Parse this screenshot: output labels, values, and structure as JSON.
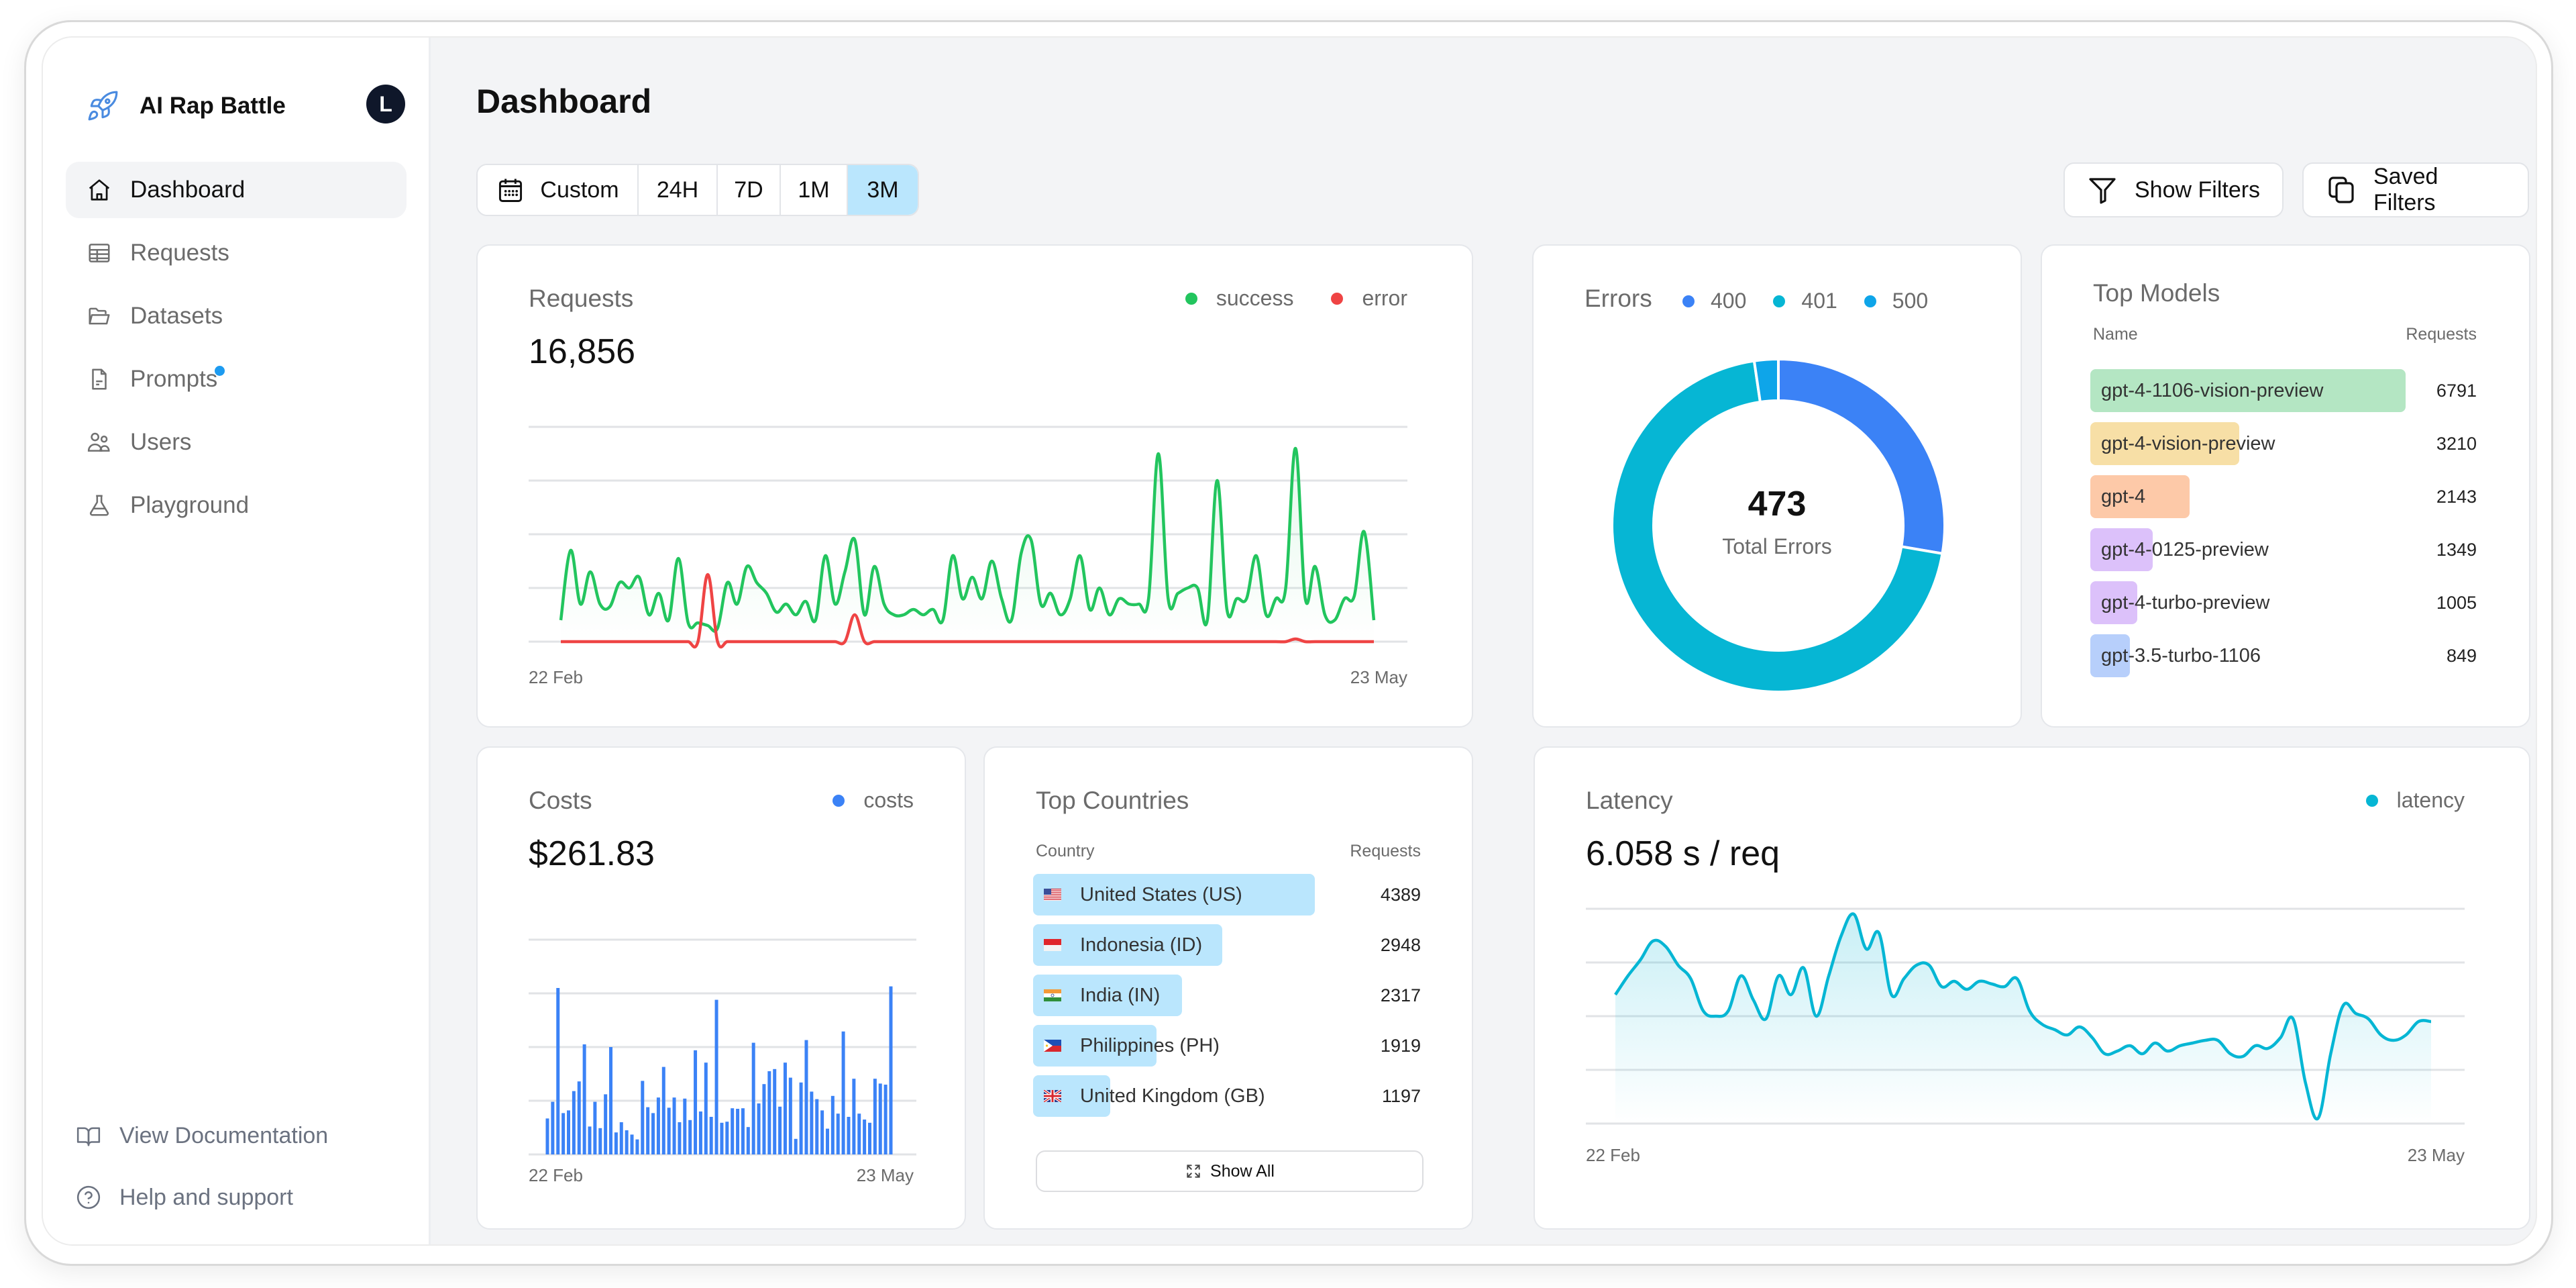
{
  "app": {
    "name": "AI Rap Battle",
    "avatar_initial": "L"
  },
  "sidebar": {
    "items": [
      {
        "label": "Dashboard",
        "icon": "home-icon",
        "active": true
      },
      {
        "label": "Requests",
        "icon": "table-icon",
        "active": false
      },
      {
        "label": "Datasets",
        "icon": "folder-icon",
        "active": false
      },
      {
        "label": "Prompts",
        "icon": "document-icon",
        "active": false,
        "badge_dot": true
      },
      {
        "label": "Users",
        "icon": "users-icon",
        "active": false
      },
      {
        "label": "Playground",
        "icon": "beaker-icon",
        "active": false
      }
    ],
    "footer": [
      {
        "label": "View Documentation",
        "icon": "book-icon"
      },
      {
        "label": "Help and support",
        "icon": "help-circle-icon"
      }
    ]
  },
  "header": {
    "title": "Dashboard",
    "time_range": {
      "options": [
        "Custom",
        "24H",
        "7D",
        "1M",
        "3M"
      ],
      "selected": "3M"
    },
    "show_filters_label": "Show Filters",
    "saved_filters_label": "Saved Filters"
  },
  "colors": {
    "success": "#22c55e",
    "error": "#ef4444",
    "costs": "#3b82f6",
    "latency": "#06b6d4",
    "err400": "#3b82f6",
    "err401": "#06b6d4",
    "err500": "#0ea5e9",
    "selected_range": "#bae6fd",
    "country_bar": "#bae6fd"
  },
  "requests_card": {
    "title": "Requests",
    "total": "16,856",
    "legend": [
      "success",
      "error"
    ],
    "x_start": "22 Feb",
    "x_end": "23 May"
  },
  "errors_card": {
    "title": "Errors",
    "legend": [
      "400",
      "401",
      "500"
    ],
    "total": "473",
    "total_label": "Total Errors"
  },
  "top_models": {
    "title": "Top Models",
    "col_name": "Name",
    "col_requests": "Requests",
    "rows": [
      {
        "name": "gpt-4-1106-vision-preview",
        "requests": "6791",
        "color": "#b4e6c3"
      },
      {
        "name": "gpt-4-vision-preview",
        "requests": "3210",
        "color": "#f7dfa6"
      },
      {
        "name": "gpt-4",
        "requests": "2143",
        "color": "#fdc9a8"
      },
      {
        "name": "gpt-4-0125-preview",
        "requests": "1349",
        "color": "#dcc1fa"
      },
      {
        "name": "gpt-4-turbo-preview",
        "requests": "1005",
        "color": "#dcc1fa"
      },
      {
        "name": "gpt-3.5-turbo-1106",
        "requests": "849",
        "color": "#b7cffb"
      }
    ]
  },
  "costs_card": {
    "title": "Costs",
    "total": "$261.83",
    "legend": [
      "costs"
    ],
    "x_start": "22 Feb",
    "x_end": "23 May"
  },
  "top_countries": {
    "title": "Top Countries",
    "col_country": "Country",
    "col_requests": "Requests",
    "rows": [
      {
        "name": "United States (US)",
        "flag": "us",
        "requests": "4389"
      },
      {
        "name": "Indonesia (ID)",
        "flag": "id",
        "requests": "2948"
      },
      {
        "name": "India (IN)",
        "flag": "in",
        "requests": "2317"
      },
      {
        "name": "Philippines (PH)",
        "flag": "ph",
        "requests": "1919"
      },
      {
        "name": "United Kingdom (GB)",
        "flag": "gb",
        "requests": "1197"
      }
    ],
    "show_all_label": "Show All"
  },
  "latency_card": {
    "title": "Latency",
    "value": "6.058 s / req",
    "legend": [
      "latency"
    ],
    "x_start": "22 Feb",
    "x_end": "23 May"
  },
  "chart_data": [
    {
      "type": "line",
      "title": "Requests",
      "x_range": [
        "22 Feb",
        "23 May"
      ],
      "grid": true,
      "ylim": [
        0,
        4
      ],
      "series": [
        {
          "name": "success",
          "values": [
            0.4,
            1.7,
            0.7,
            1.3,
            0.7,
            0.65,
            1.1,
            1.0,
            1.2,
            0.5,
            0.9,
            0.4,
            1.55,
            0.35,
            0.35,
            0.3,
            0.25,
            1.1,
            0.7,
            1.4,
            1.1,
            0.9,
            0.55,
            0.7,
            0.5,
            0.75,
            0.4,
            1.6,
            0.7,
            1.3,
            1.9,
            0.5,
            1.4,
            0.7,
            0.5,
            0.5,
            0.6,
            0.5,
            0.6,
            0.4,
            1.6,
            0.8,
            1.2,
            0.8,
            1.5,
            0.8,
            0.4,
            1.65,
            1.9,
            0.7,
            0.9,
            0.5,
            0.8,
            1.6,
            0.6,
            1.0,
            0.5,
            0.8,
            0.7,
            0.7,
            0.8,
            3.5,
            0.8,
            0.9,
            1.0,
            1.0,
            0.4,
            3.0,
            0.6,
            0.8,
            0.8,
            1.6,
            0.5,
            0.8,
            1.0,
            3.6,
            0.8,
            1.4,
            0.5,
            0.4,
            0.8,
            0.85,
            2.05,
            0.4
          ]
        },
        {
          "name": "error",
          "values": [
            0,
            0,
            0,
            0,
            0,
            0,
            0,
            0,
            0,
            0,
            0,
            0,
            0,
            0,
            0,
            1.25,
            0,
            0,
            0,
            0,
            0,
            0,
            0,
            0,
            0,
            0,
            0,
            0,
            0,
            0,
            0.5,
            0,
            0,
            0,
            0,
            0,
            0,
            0,
            0,
            0,
            0,
            0,
            0,
            0,
            0,
            0,
            0,
            0,
            0,
            0,
            0,
            0,
            0,
            0,
            0,
            0,
            0,
            0,
            0,
            0,
            0,
            0,
            0,
            0,
            0,
            0,
            0,
            0,
            0,
            0,
            0,
            0,
            0,
            0,
            0,
            0.05,
            0,
            0,
            0,
            0,
            0,
            0,
            0,
            0
          ]
        }
      ]
    },
    {
      "type": "pie",
      "title": "Errors",
      "donut": true,
      "categories": [
        "400",
        "401",
        "500"
      ],
      "values": [
        131,
        331,
        11
      ],
      "center_label": "473 Total Errors"
    },
    {
      "type": "bar",
      "title": "Top Models",
      "orientation": "horizontal",
      "categories": [
        "gpt-4-1106-vision-preview",
        "gpt-4-vision-preview",
        "gpt-4",
        "gpt-4-0125-preview",
        "gpt-4-turbo-preview",
        "gpt-3.5-turbo-1106"
      ],
      "values": [
        6791,
        3210,
        2143,
        1349,
        1005,
        849
      ]
    },
    {
      "type": "bar",
      "title": "Costs",
      "x_range": [
        "22 Feb",
        "23 May"
      ],
      "grid": true,
      "ylim": [
        0,
        4
      ],
      "values": [
        0.67,
        0.98,
        3.1,
        0.77,
        0.82,
        1.18,
        1.36,
        2.05,
        0.52,
        0.98,
        0.49,
        1.12,
        2.0,
        0.41,
        0.6,
        0.45,
        0.37,
        0.28,
        1.37,
        0.88,
        0.77,
        1.06,
        1.63,
        0.87,
        1.06,
        0.6,
        1.04,
        0.64,
        1.94,
        0.8,
        1.71,
        0.7,
        2.88,
        0.59,
        0.61,
        0.86,
        0.85,
        0.86,
        0.51,
        2.08,
        0.95,
        1.31,
        1.55,
        1.59,
        0.89,
        1.71,
        1.43,
        0.29,
        1.34,
        2.13,
        1.17,
        1.03,
        0.82,
        0.48,
        1.09,
        0.76,
        2.29,
        0.7,
        1.41,
        0.76,
        0.65,
        0.59,
        1.41,
        1.32,
        1.3,
        3.13
      ]
    },
    {
      "type": "bar",
      "title": "Top Countries",
      "orientation": "horizontal",
      "categories": [
        "United States (US)",
        "Indonesia (ID)",
        "India (IN)",
        "Philippines (PH)",
        "United Kingdom (GB)"
      ],
      "values": [
        4389,
        2948,
        2317,
        1919,
        1197
      ]
    },
    {
      "type": "area",
      "title": "Latency",
      "x_range": [
        "22 Feb",
        "23 May"
      ],
      "grid": true,
      "ylim": [
        0,
        4
      ],
      "series": [
        {
          "name": "latency",
          "values": [
            2.4,
            2.75,
            3.05,
            3.4,
            3.3,
            2.95,
            2.7,
            2.1,
            2.0,
            2.1,
            2.75,
            2.3,
            1.95,
            2.75,
            2.4,
            2.9,
            2.0,
            2.75,
            3.5,
            3.9,
            3.25,
            3.55,
            2.4,
            2.7,
            2.95,
            2.95,
            2.55,
            2.65,
            2.5,
            2.65,
            2.6,
            2.55,
            2.7,
            2.1,
            1.85,
            1.75,
            1.65,
            1.8,
            1.6,
            1.3,
            1.35,
            1.45,
            1.3,
            1.5,
            1.35,
            1.45,
            1.5,
            1.55,
            1.55,
            1.3,
            1.25,
            1.45,
            1.4,
            1.6,
            1.95,
            0.75,
            0.1,
            1.3,
            2.2,
            2.05,
            1.95,
            1.65,
            1.55,
            1.65,
            1.9,
            1.9
          ]
        }
      ]
    }
  ]
}
